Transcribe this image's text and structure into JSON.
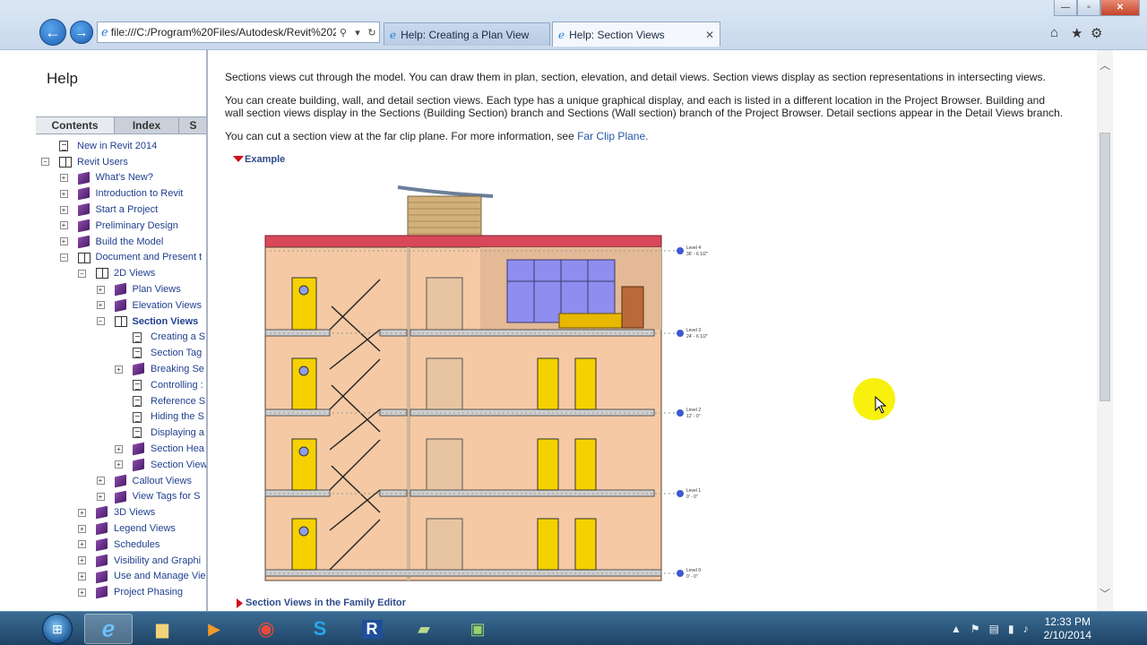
{
  "browser": {
    "address": "file:///C:/Program%20Files/Autodesk/Revit%202(",
    "tabs": [
      {
        "label": "Help: Creating a Plan View",
        "active": false
      },
      {
        "label": "Help: Section Views",
        "active": true
      }
    ],
    "window_buttons": {
      "minimize": "—",
      "maximize": "▫",
      "close": "✕"
    }
  },
  "help": {
    "title": "Help",
    "pane_tabs": [
      "Contents",
      "Index",
      "S"
    ],
    "tree": [
      {
        "label": "New in Revit 2014",
        "icon": "page-icon",
        "indent": 0,
        "exp": ""
      },
      {
        "label": "Revit Users",
        "icon": "open-book-icon",
        "indent": 0,
        "exp": "−"
      },
      {
        "label": "What's New?",
        "icon": "book-icon",
        "indent": 1,
        "exp": "+"
      },
      {
        "label": "Introduction to Revit",
        "icon": "book-icon",
        "indent": 1,
        "exp": "+"
      },
      {
        "label": "Start a Project",
        "icon": "book-icon",
        "indent": 1,
        "exp": "+"
      },
      {
        "label": "Preliminary Design",
        "icon": "book-icon",
        "indent": 1,
        "exp": "+"
      },
      {
        "label": "Build the Model",
        "icon": "book-icon",
        "indent": 1,
        "exp": "+"
      },
      {
        "label": "Document and Present t",
        "icon": "open-book-icon",
        "indent": 1,
        "exp": "−"
      },
      {
        "label": "2D Views",
        "icon": "open-book-icon",
        "indent": 2,
        "exp": "−"
      },
      {
        "label": "Plan Views",
        "icon": "book-icon",
        "indent": 3,
        "exp": "+"
      },
      {
        "label": "Elevation Views",
        "icon": "book-icon",
        "indent": 3,
        "exp": "+"
      },
      {
        "label": "Section Views",
        "icon": "open-book-icon",
        "indent": 3,
        "exp": "−",
        "selected": true
      },
      {
        "label": "Creating a S",
        "icon": "page-icon",
        "indent": 4,
        "exp": ""
      },
      {
        "label": "Section Tag",
        "icon": "page-icon",
        "indent": 4,
        "exp": ""
      },
      {
        "label": "Breaking Se",
        "icon": "book-icon",
        "indent": 4,
        "exp": "+"
      },
      {
        "label": "Controlling :",
        "icon": "page-icon",
        "indent": 4,
        "exp": ""
      },
      {
        "label": "Reference S",
        "icon": "page-icon",
        "indent": 4,
        "exp": ""
      },
      {
        "label": "Hiding the S",
        "icon": "page-icon",
        "indent": 4,
        "exp": ""
      },
      {
        "label": "Displaying a",
        "icon": "page-icon",
        "indent": 4,
        "exp": ""
      },
      {
        "label": "Section Hea",
        "icon": "book-icon",
        "indent": 4,
        "exp": "+"
      },
      {
        "label": "Section View",
        "icon": "book-icon",
        "indent": 4,
        "exp": "+"
      },
      {
        "label": "Callout Views",
        "icon": "book-icon",
        "indent": 3,
        "exp": "+"
      },
      {
        "label": "View Tags for S",
        "icon": "book-icon",
        "indent": 3,
        "exp": "+"
      },
      {
        "label": "3D Views",
        "icon": "book-icon",
        "indent": 2,
        "exp": "+"
      },
      {
        "label": "Legend Views",
        "icon": "book-icon",
        "indent": 2,
        "exp": "+"
      },
      {
        "label": "Schedules",
        "icon": "book-icon",
        "indent": 2,
        "exp": "+"
      },
      {
        "label": "Visibility and Graphi",
        "icon": "book-icon",
        "indent": 2,
        "exp": "+"
      },
      {
        "label": "Use and Manage Vie",
        "icon": "book-icon",
        "indent": 2,
        "exp": "+"
      },
      {
        "label": "Project Phasing",
        "icon": "book-icon",
        "indent": 2,
        "exp": "+"
      }
    ]
  },
  "article": {
    "p1": "Sections views cut through the model. You can draw them in plan, section, elevation, and detail views. Section views display as section representations in intersecting views.",
    "p2a": "You can create building, wall, and detail section views. Each type has a unique graphical display, and each is listed in a different location in the Project Browser. Building and",
    "p2b": "wall section views display in the Sections (Building Section) branch and Sections (Wall section) branch of the Project Browser. Detail sections appear in the Detail Views branch.",
    "p3": "You can cut a section view at the far clip plane. For more information, see ",
    "p3_link": "Far Clip Plane.",
    "example_label": "Example",
    "family_editor_label": "Section Views in the Family Editor",
    "levels": [
      {
        "name": "Level 4",
        "elev": "36' - 6 1/2\""
      },
      {
        "name": "Level 3",
        "elev": "24' - 6 1/2\""
      },
      {
        "name": "Level 2",
        "elev": "12' - 0\""
      },
      {
        "name": "Level 1",
        "elev": "0' - 0\""
      },
      {
        "name": "Level 0",
        "elev": "0' - 0\""
      }
    ]
  },
  "taskbar": {
    "time": "12:33 PM",
    "date": "2/10/2014"
  },
  "colors": {
    "link": "#2457a6",
    "tree_text": "#1f3f8f",
    "wall": "#f4c9a4",
    "roof": "#d9475a",
    "door": "#f6d100",
    "cursor_highlight": "#f7f000"
  }
}
